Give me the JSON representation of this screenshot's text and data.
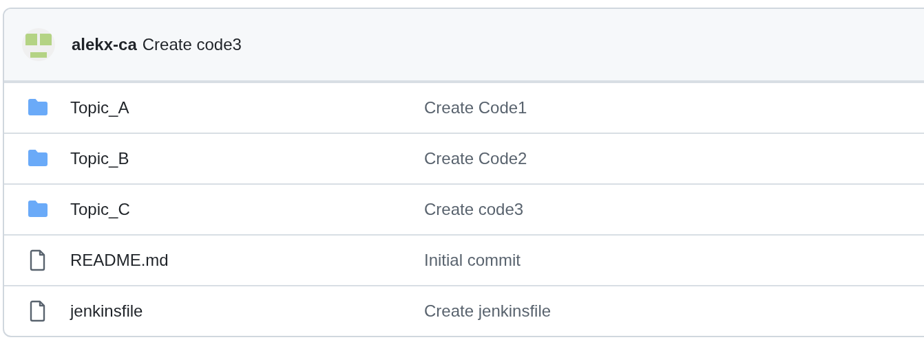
{
  "latest_commit": {
    "author": "alekx-ca",
    "message": "Create code3"
  },
  "files": [
    {
      "kind": "folder",
      "name": "Topic_A",
      "commit_message": "Create Code1"
    },
    {
      "kind": "folder",
      "name": "Topic_B",
      "commit_message": "Create Code2"
    },
    {
      "kind": "folder",
      "name": "Topic_C",
      "commit_message": "Create code3"
    },
    {
      "kind": "file",
      "name": "README.md",
      "commit_message": "Initial commit"
    },
    {
      "kind": "file",
      "name": "jenkinsfile",
      "commit_message": "Create jenkinsfile"
    }
  ]
}
